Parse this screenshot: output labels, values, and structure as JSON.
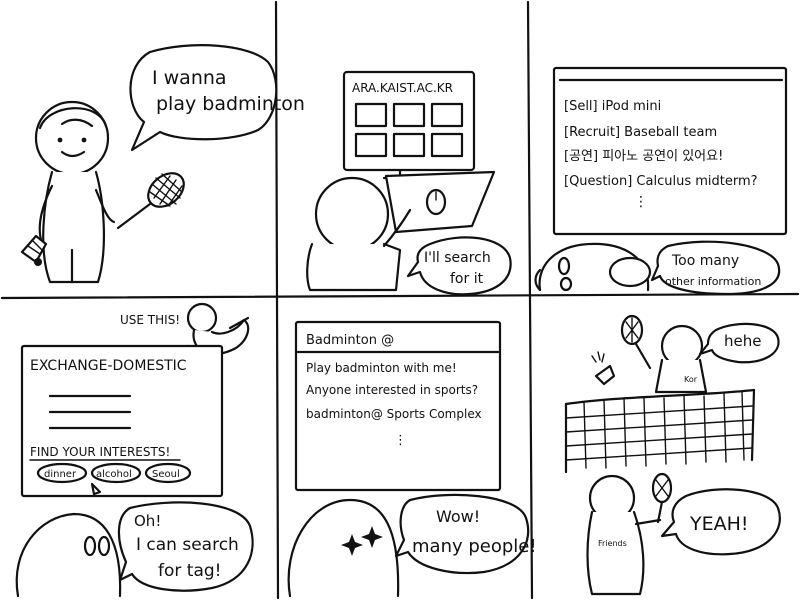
{
  "panel1": {
    "speech": [
      "I wanna",
      "play badminton"
    ]
  },
  "panel2": {
    "site": "ARA.KAIST.AC.KR",
    "speech": [
      "I'll search",
      "for it"
    ]
  },
  "panel3": {
    "posts": [
      "[Sell] iPod mini",
      "[Recruit] Baseball team",
      "[공연] 피아노 공연이 있어요!",
      "[Question] Calculus midterm?",
      "⋮"
    ],
    "speech": [
      "Too many",
      "other information"
    ]
  },
  "panel4": {
    "bird_label": "USE THIS!",
    "board_title": "EXCHANGE-DOMESTIC",
    "find_label": "FIND YOUR INTERESTS!",
    "tags": [
      "dinner",
      "alcohol",
      "Seoul"
    ],
    "speech": [
      "Oh!",
      "I can search",
      "for tag!"
    ]
  },
  "panel5": {
    "board_title": "Badminton @",
    "posts": [
      "Play badminton with me!",
      "Anyone interested in sports?",
      "badminton@ Sports Complex",
      "⋮"
    ],
    "speech": [
      "Wow!",
      "many people!"
    ]
  },
  "panel6": {
    "speech_top": "hehe",
    "speech_bottom": "YEAH!",
    "label_kor": "Kor",
    "label_friend": "Friends"
  }
}
